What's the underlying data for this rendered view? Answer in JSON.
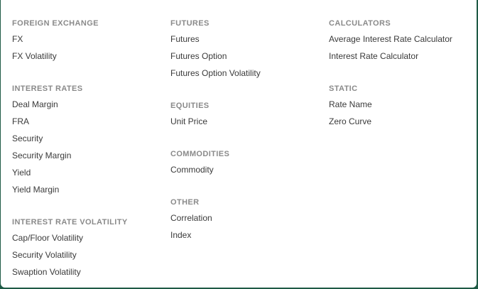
{
  "menu": {
    "columns": [
      {
        "sections": [
          {
            "title": "FOREIGN EXCHANGE",
            "items": [
              "FX",
              "FX Volatility"
            ]
          },
          {
            "title": "INTEREST RATES",
            "items": [
              "Deal Margin",
              "FRA",
              "Security",
              "Security Margin",
              "Yield",
              "Yield Margin"
            ]
          },
          {
            "title": "INTEREST RATE VOLATILITY",
            "items": [
              "Cap/Floor Volatility",
              "Security Volatility",
              "Swaption Volatility"
            ]
          }
        ]
      },
      {
        "sections": [
          {
            "title": "FUTURES",
            "items": [
              "Futures",
              "Futures Option",
              "Futures Option Volatility"
            ]
          },
          {
            "title": "EQUITIES",
            "items": [
              "Unit Price"
            ]
          },
          {
            "title": "COMMODITIES",
            "items": [
              "Commodity"
            ]
          },
          {
            "title": "OTHER",
            "items": [
              "Correlation",
              "Index"
            ]
          }
        ]
      },
      {
        "sections": [
          {
            "title": "CALCULATORS",
            "items": [
              "Average Interest Rate Calculator",
              "Interest Rate Calculator"
            ]
          },
          {
            "title": "STATIC",
            "items": [
              "Rate Name",
              "Zero Curve"
            ]
          }
        ]
      }
    ]
  }
}
